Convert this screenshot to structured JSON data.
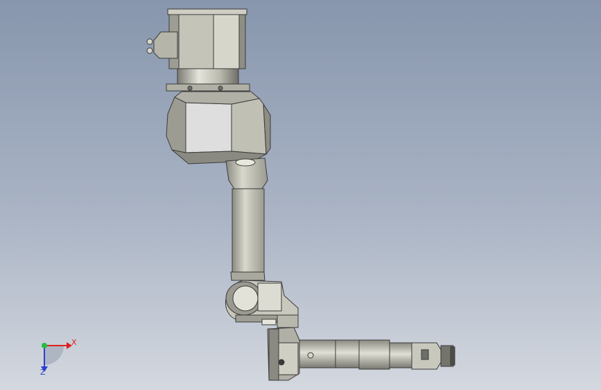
{
  "viewport": {
    "background_top": "#8796ad",
    "background_bottom": "#d4d8df",
    "model": "robot-arm-assembly"
  },
  "triad": {
    "x_label": "X",
    "z_label": "Z",
    "x_color": "#e02020",
    "y_color": "#20c040",
    "z_color": "#2a3fd0"
  },
  "colors": {
    "part_light": "#d8d8cc",
    "part_mid": "#b3b3a8",
    "part_dark": "#6e6e68",
    "edge": "#3a3a3a"
  }
}
